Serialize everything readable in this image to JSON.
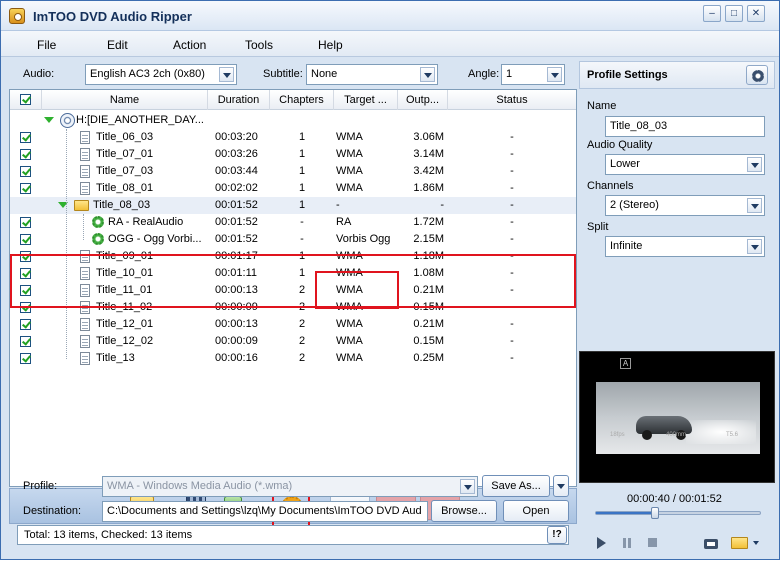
{
  "window": {
    "title": "ImTOO DVD Audio Ripper"
  },
  "menu": [
    "File",
    "Edit",
    "Action",
    "Tools",
    "Help"
  ],
  "selectors": {
    "audio_label": "Audio:",
    "audio_value": "English AC3 2ch (0x80)",
    "subtitle_label": "Subtitle:",
    "subtitle_value": "None",
    "angle_label": "Angle:",
    "angle_value": "1"
  },
  "table": {
    "columns": [
      "Name",
      "Duration",
      "Chapters",
      "Target ...",
      "Outp...",
      "Status"
    ],
    "rows": [
      {
        "name": "H:[DIE_ANOTHER_DAY...",
        "duration": "",
        "chapters": "",
        "target": "",
        "output": "",
        "status": "",
        "kind": "disc",
        "check": false
      },
      {
        "name": "Title_06_03",
        "duration": "00:03:20",
        "chapters": "1",
        "target": "WMA",
        "output": "3.06M",
        "status": "-",
        "kind": "doc",
        "check": true
      },
      {
        "name": "Title_07_01",
        "duration": "00:03:26",
        "chapters": "1",
        "target": "WMA",
        "output": "3.14M",
        "status": "-",
        "kind": "doc",
        "check": true
      },
      {
        "name": "Title_07_03",
        "duration": "00:03:44",
        "chapters": "1",
        "target": "WMA",
        "output": "3.42M",
        "status": "-",
        "kind": "doc",
        "check": true
      },
      {
        "name": "Title_08_01",
        "duration": "00:02:02",
        "chapters": "1",
        "target": "WMA",
        "output": "1.86M",
        "status": "-",
        "kind": "doc",
        "check": true
      },
      {
        "name": "Title_08_03",
        "duration": "00:01:52",
        "chapters": "1",
        "target": "-",
        "output": "-",
        "status": "-",
        "kind": "folder",
        "check": false
      },
      {
        "name": "RA - RealAudio",
        "duration": "00:01:52",
        "chapters": "-",
        "target": "RA",
        "output": "1.72M",
        "status": "-",
        "kind": "gear",
        "check": true
      },
      {
        "name": "OGG - Ogg Vorbi...",
        "duration": "00:01:52",
        "chapters": "-",
        "target": "Vorbis Ogg",
        "output": "2.15M",
        "status": "-",
        "kind": "gear",
        "check": true
      },
      {
        "name": "Title_09_01",
        "duration": "00:01:17",
        "chapters": "1",
        "target": "WMA",
        "output": "1.18M",
        "status": "-",
        "kind": "doc",
        "check": true
      },
      {
        "name": "Title_10_01",
        "duration": "00:01:11",
        "chapters": "1",
        "target": "WMA",
        "output": "1.08M",
        "status": "-",
        "kind": "doc",
        "check": true
      },
      {
        "name": "Title_11_01",
        "duration": "00:00:13",
        "chapters": "2",
        "target": "WMA",
        "output": "0.21M",
        "status": "-",
        "kind": "doc",
        "check": true
      },
      {
        "name": "Title_11_02",
        "duration": "00:00:09",
        "chapters": "2",
        "target": "WMA",
        "output": "0.15M",
        "status": "-",
        "kind": "doc",
        "check": true
      },
      {
        "name": "Title_12_01",
        "duration": "00:00:13",
        "chapters": "2",
        "target": "WMA",
        "output": "0.21M",
        "status": "-",
        "kind": "doc",
        "check": true
      },
      {
        "name": "Title_12_02",
        "duration": "00:00:09",
        "chapters": "2",
        "target": "WMA",
        "output": "0.15M",
        "status": "-",
        "kind": "doc",
        "check": true
      },
      {
        "name": "Title_13",
        "duration": "00:00:16",
        "chapters": "2",
        "target": "WMA",
        "output": "0.25M",
        "status": "-",
        "kind": "doc",
        "check": true
      }
    ]
  },
  "bottom": {
    "profile_label": "Profile:",
    "profile_value": "WMA - Windows Media Audio  (*.wma)",
    "save_as": "Save As...",
    "destination_label": "Destination:",
    "destination_value": "C:\\Documents and Settings\\lzq\\My Documents\\ImTOO DVD Aud",
    "browse": "Browse...",
    "open": "Open",
    "status_text": "Total: 13 items, Checked: 13 items",
    "help_button": "!?"
  },
  "profile_settings": {
    "title": "Profile Settings",
    "name_label": "Name",
    "name_value": "Title_08_03",
    "quality_label": "Audio Quality",
    "quality_value": "Lower",
    "channels_label": "Channels",
    "channels_value": "2 (Stereo)",
    "split_label": "Split",
    "split_value": "Infinite"
  },
  "player": {
    "current_time": "00:00:40",
    "total_time": "00:01:52",
    "time_separator": "/",
    "progress": 0.36,
    "osd_badge": "A",
    "osd_left": "18fps",
    "osd_mid": "400mm",
    "osd_right": "T5.6"
  },
  "colors": {
    "highlight_box": "#e0141e",
    "accent": "#3c6db0"
  }
}
